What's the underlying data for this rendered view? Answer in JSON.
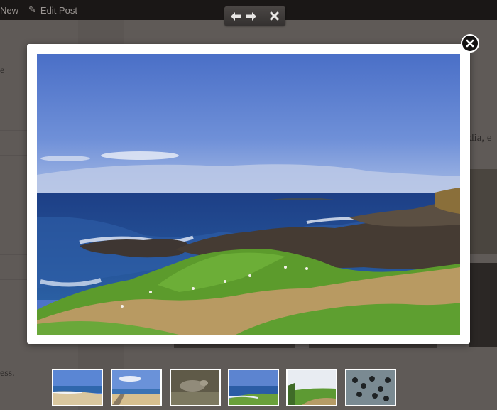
{
  "adminbar": {
    "new_label": "New",
    "edit_post_label": "Edit Post"
  },
  "background": {
    "text_left": "e",
    "text_right": "dia, e",
    "text_bottom": "ess."
  },
  "toolbar": {
    "arrows_icon": "left-right-arrows-icon",
    "close_icon": "x-icon"
  },
  "lightbox": {
    "photo_subject": "coastal-landscape",
    "close_icon": "close-circle-icon"
  },
  "thumbnails": [
    {
      "subject": "beach"
    },
    {
      "subject": "boardwalk"
    },
    {
      "subject": "seal"
    },
    {
      "subject": "coastline"
    },
    {
      "subject": "hillside"
    },
    {
      "subject": "penguins"
    }
  ],
  "colors": {
    "overlay": "#5f5a57",
    "frame": "#ffffff",
    "toolbar": "#3a3634"
  }
}
